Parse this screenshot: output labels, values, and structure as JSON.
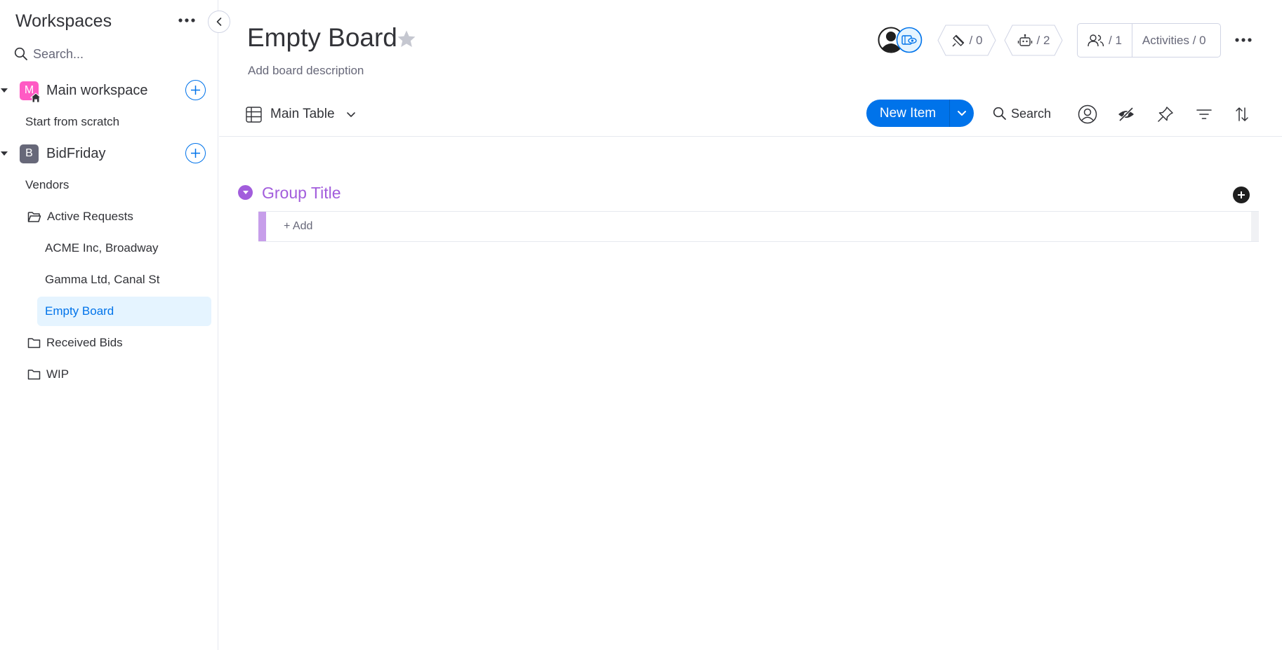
{
  "sidebar": {
    "title": "Workspaces",
    "search_placeholder": "Search...",
    "workspaces": [
      {
        "initial": "M",
        "label": "Main workspace",
        "color": "#ff5ac4"
      },
      {
        "initial": "B",
        "label": "BidFriday",
        "color": "#676879"
      }
    ],
    "items": [
      {
        "label": "Start from scratch"
      },
      {
        "label": "Vendors"
      },
      {
        "label": "Active Requests"
      },
      {
        "label": "ACME Inc, Broadway"
      },
      {
        "label": "Gamma Ltd, Canal St"
      },
      {
        "label": "Empty Board",
        "selected": true
      },
      {
        "label": "Received Bids"
      },
      {
        "label": "WIP"
      }
    ]
  },
  "header": {
    "title": "Empty Board",
    "description": "Add board description",
    "integrations": "/ 0",
    "automations": "/ 2",
    "members": "/ 1",
    "activities": "Activities / 0"
  },
  "toolbar": {
    "view_label": "Main Table",
    "new_item_label": "New Item",
    "search_label": "Search"
  },
  "group": {
    "title": "Group Title",
    "add_label": "+ Add",
    "color": "#a25ddc"
  },
  "colors": {
    "accent": "#0073ea",
    "selected_bg": "#e5f4ff",
    "text": "#323338",
    "muted": "#676879"
  }
}
